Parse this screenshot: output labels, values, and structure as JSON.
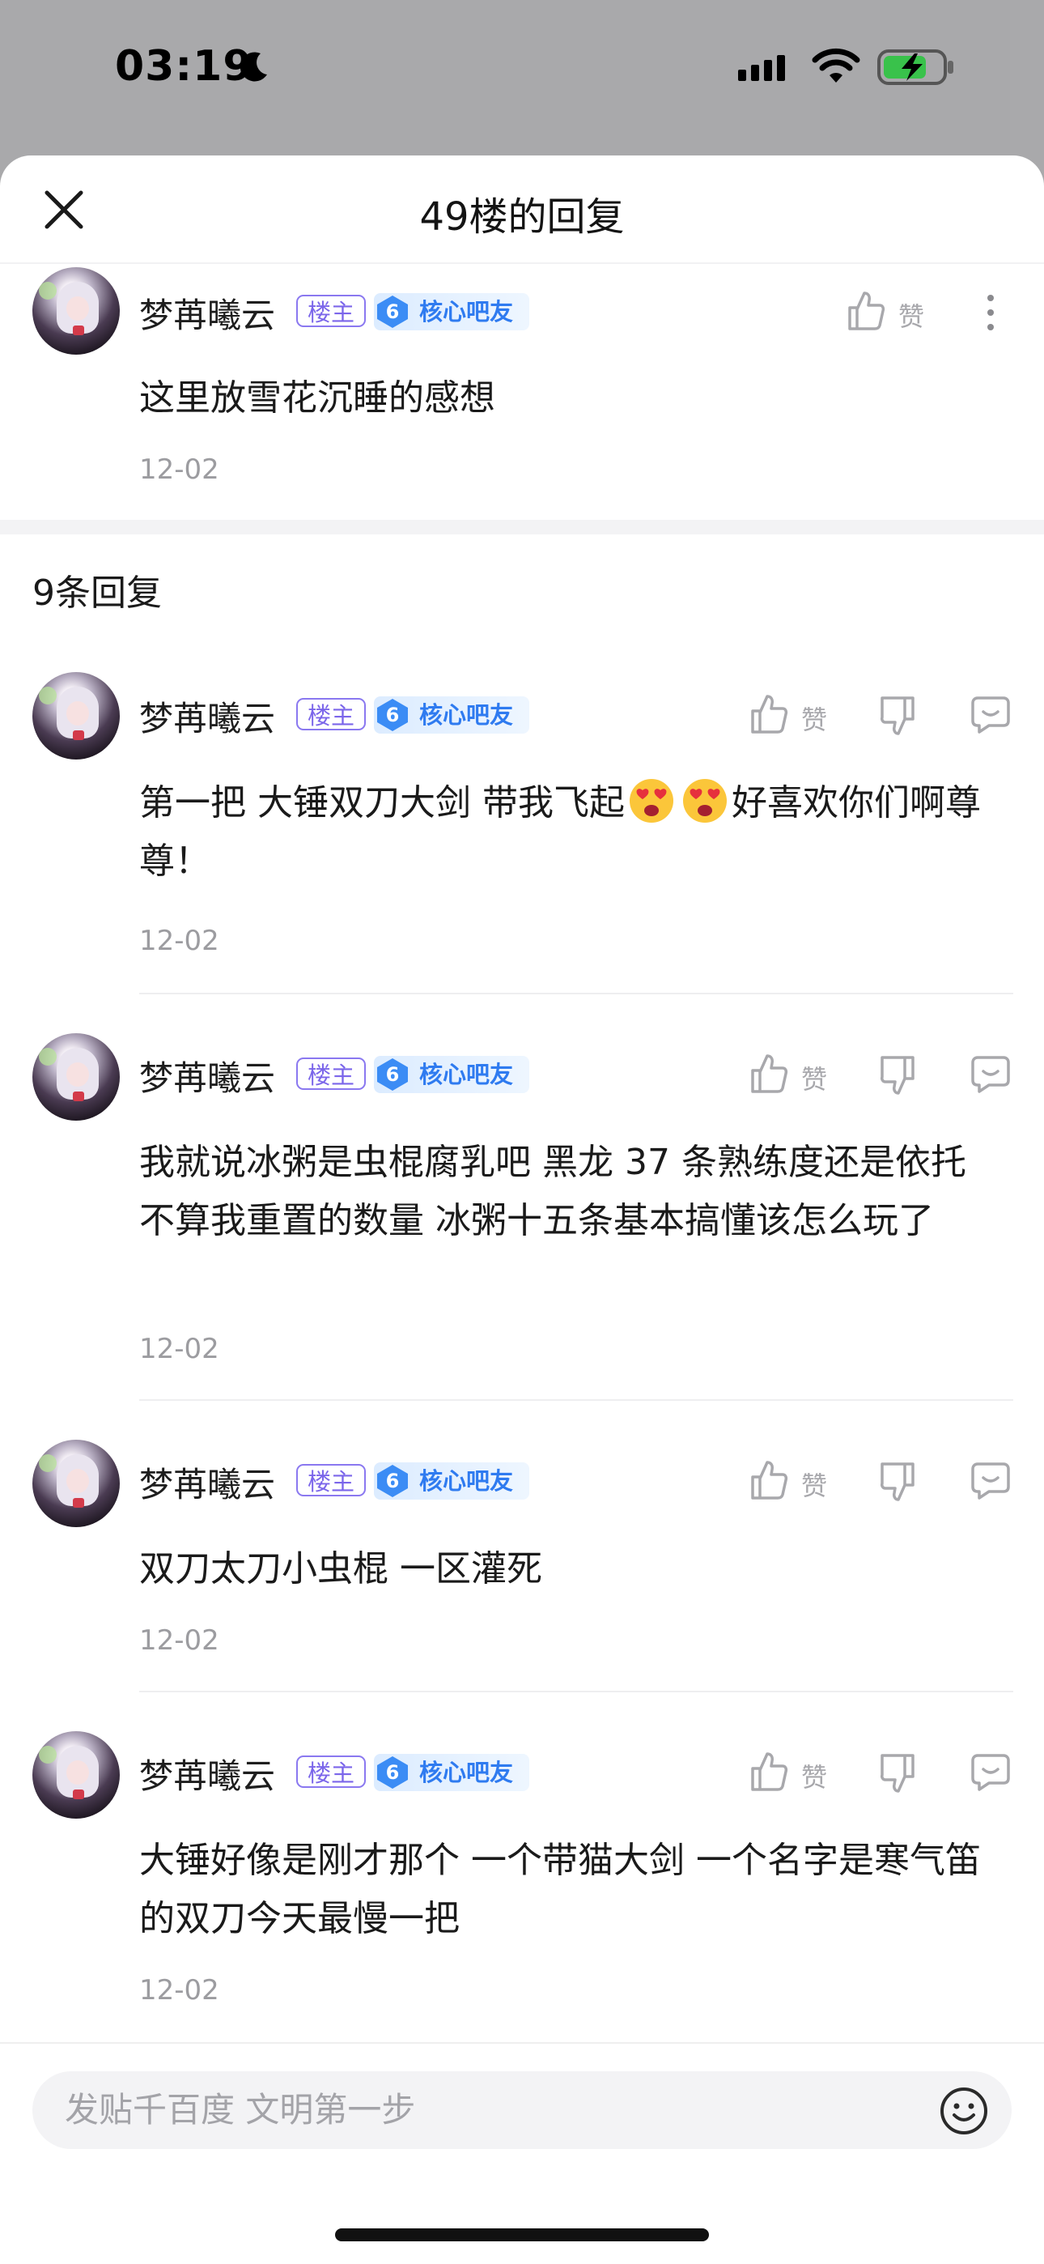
{
  "status_bar": {
    "time": "03:19"
  },
  "sheet": {
    "title": "49楼的回复"
  },
  "main_post": {
    "username": "梦苒曦云",
    "owner_badge": "楼主",
    "level_number": "6",
    "level_label": "核心吧友",
    "like_label": "赞",
    "text": "这里放雪花沉睡的感想",
    "date": "12-02"
  },
  "replies_header": {
    "count_label": "9条回复"
  },
  "replies": [
    {
      "username": "梦苒曦云",
      "owner_badge": "楼主",
      "level_number": "6",
      "level_label": "核心吧友",
      "like_label": "赞",
      "text_before": "第一把 大锤双刀大剑 带我飞起",
      "emojis": [
        "heart-eyes-emoji",
        "heart-eyes-emoji"
      ],
      "text_after": "好喜欢你们啊尊尊！",
      "date": "12-02"
    },
    {
      "username": "梦苒曦云",
      "owner_badge": "楼主",
      "level_number": "6",
      "level_label": "核心吧友",
      "like_label": "赞",
      "text": "我就说冰粥是虫棍腐乳吧 黑龙 37 条熟练度还是依托 不算我重置的数量 冰粥十五条基本搞懂该怎么玩了",
      "date": "12-02"
    },
    {
      "username": "梦苒曦云",
      "owner_badge": "楼主",
      "level_number": "6",
      "level_label": "核心吧友",
      "like_label": "赞",
      "text": "双刀太刀小虫棍 一区灌死",
      "date": "12-02"
    },
    {
      "username": "梦苒曦云",
      "owner_badge": "楼主",
      "level_number": "6",
      "level_label": "核心吧友",
      "like_label": "赞",
      "text": "大锤好像是刚才那个 一个带猫大剑 一个名字是寒气笛的双刀今天最慢一把",
      "date": "12-02"
    }
  ],
  "input": {
    "placeholder": "发贴千百度 文明第一步"
  },
  "colors": {
    "owner_badge": "#7b66ea",
    "level_badge": "#2f7bf0",
    "date": "#9c9ca0"
  }
}
